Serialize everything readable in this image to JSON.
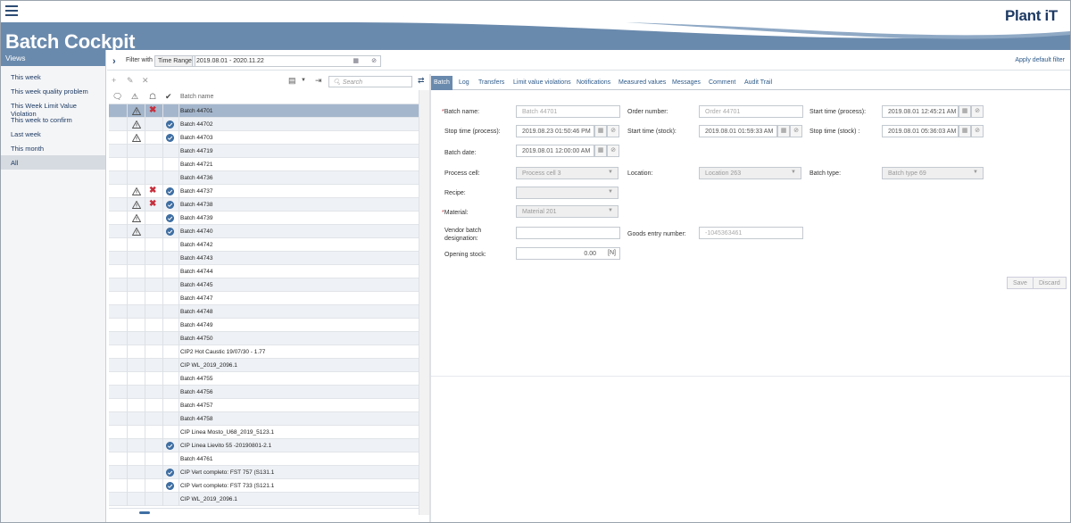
{
  "app": {
    "title": "Batch Cockpit",
    "logo": "Plant iT"
  },
  "sidebar": {
    "header": "Views",
    "items": [
      {
        "label": "This week"
      },
      {
        "label": "This week quality problem"
      },
      {
        "label": "This Week Limit Value Violation"
      },
      {
        "label": "This week to confirm"
      },
      {
        "label": "Last week"
      },
      {
        "label": "This month"
      },
      {
        "label": "All",
        "selected": true
      }
    ]
  },
  "filter": {
    "filter_with": "Filter with",
    "time_range_label": "Time Range",
    "time_range_value": "2019.08.01 - 2020.11.22",
    "apply_default": "Apply default filter"
  },
  "list": {
    "search_placeholder": "Search",
    "column_name": "Batch name",
    "rows": [
      {
        "name": "Batch 44701",
        "warn": true,
        "x": true,
        "ok": false,
        "selected": true
      },
      {
        "name": "Batch 44702",
        "warn": true,
        "x": false,
        "ok": true
      },
      {
        "name": "Batch 44703",
        "warn": true,
        "x": false,
        "ok": true
      },
      {
        "name": "Batch 44719",
        "warn": false,
        "x": false,
        "ok": false
      },
      {
        "name": "Batch 44721",
        "warn": false,
        "x": false,
        "ok": false
      },
      {
        "name": "Batch 44736",
        "warn": false,
        "x": false,
        "ok": false
      },
      {
        "name": "Batch 44737",
        "warn": true,
        "x": true,
        "ok": true
      },
      {
        "name": "Batch 44738",
        "warn": true,
        "x": true,
        "ok": true
      },
      {
        "name": "Batch 44739",
        "warn": true,
        "x": false,
        "ok": true
      },
      {
        "name": "Batch 44740",
        "warn": true,
        "x": false,
        "ok": true
      },
      {
        "name": "Batch 44742",
        "warn": false,
        "x": false,
        "ok": false
      },
      {
        "name": "Batch 44743",
        "warn": false,
        "x": false,
        "ok": false
      },
      {
        "name": "Batch 44744",
        "warn": false,
        "x": false,
        "ok": false
      },
      {
        "name": "Batch 44745",
        "warn": false,
        "x": false,
        "ok": false
      },
      {
        "name": "Batch 44747",
        "warn": false,
        "x": false,
        "ok": false
      },
      {
        "name": "Batch 44748",
        "warn": false,
        "x": false,
        "ok": false
      },
      {
        "name": "Batch 44749",
        "warn": false,
        "x": false,
        "ok": false
      },
      {
        "name": "Batch 44750",
        "warn": false,
        "x": false,
        "ok": false
      },
      {
        "name": "CIP2 Hot Caustic 19/07/30 - 1.77",
        "warn": false,
        "x": false,
        "ok": false
      },
      {
        "name": "CIP WL_2019_2096.1",
        "warn": false,
        "x": false,
        "ok": false
      },
      {
        "name": "Batch 44755",
        "warn": false,
        "x": false,
        "ok": false
      },
      {
        "name": "Batch 44756",
        "warn": false,
        "x": false,
        "ok": false
      },
      {
        "name": "Batch 44757",
        "warn": false,
        "x": false,
        "ok": false
      },
      {
        "name": "Batch 44758",
        "warn": false,
        "x": false,
        "ok": false
      },
      {
        "name": "CIP Linea Mosto_U68_2019_5123.1",
        "warn": false,
        "x": false,
        "ok": false
      },
      {
        "name": "CIP Linea Lievito 55 -20190801-2.1",
        "warn": false,
        "x": false,
        "ok": true
      },
      {
        "name": "Batch 44761",
        "warn": false,
        "x": false,
        "ok": false
      },
      {
        "name": "CIP Vert completo: FST 757 (S131.1",
        "warn": false,
        "x": false,
        "ok": true
      },
      {
        "name": "CIP Vert completo: FST 733 (S121.1",
        "warn": false,
        "x": false,
        "ok": true
      },
      {
        "name": "CIP WL_2019_2096.1",
        "warn": false,
        "x": false,
        "ok": false
      }
    ]
  },
  "tabs": [
    "Batch",
    "Log",
    "Transfers",
    "Limit value violations",
    "Notifications",
    "Measured values",
    "Messages",
    "Comment",
    "Audit Trail"
  ],
  "form": {
    "batch_name_label": "Batch name:",
    "batch_name_value": "Batch 44701",
    "order_number_label": "Order number:",
    "order_number_value": "Order 44701",
    "start_process_label": "Start time (process):",
    "start_process_value": "2019.08.01 12:45:21 AM",
    "stop_process_label": "Stop time (process):",
    "stop_process_value": "2019.08.23 01:50:46 PM",
    "start_stock_label": "Start time (stock):",
    "start_stock_value": "2019.08.01 01:59:33 AM",
    "stop_stock_label": "Stop time (stock) :",
    "stop_stock_value": "2019.08.01 05:36:03 AM",
    "batch_date_label": "Batch date:",
    "batch_date_value": "2019.08.01 12:00:00 AM",
    "process_cell_label": "Process cell:",
    "process_cell_value": "Process cell 3",
    "location_label": "Location:",
    "location_value": "Location 263",
    "batch_type_label": "Batch type:",
    "batch_type_value": "Batch type 69",
    "recipe_label": "Recipe:",
    "recipe_value": "",
    "material_label": "Material:",
    "material_value": "Material 201",
    "vendor_label": "Vendor batch designation:",
    "vendor_value": "",
    "goods_entry_label": "Goods entry number:",
    "goods_entry_value": "-1045363461",
    "opening_stock_label": "Opening stock:",
    "opening_stock_value": "0.00",
    "opening_stock_unit": "[N]",
    "save": "Save",
    "discard": "Discard"
  }
}
